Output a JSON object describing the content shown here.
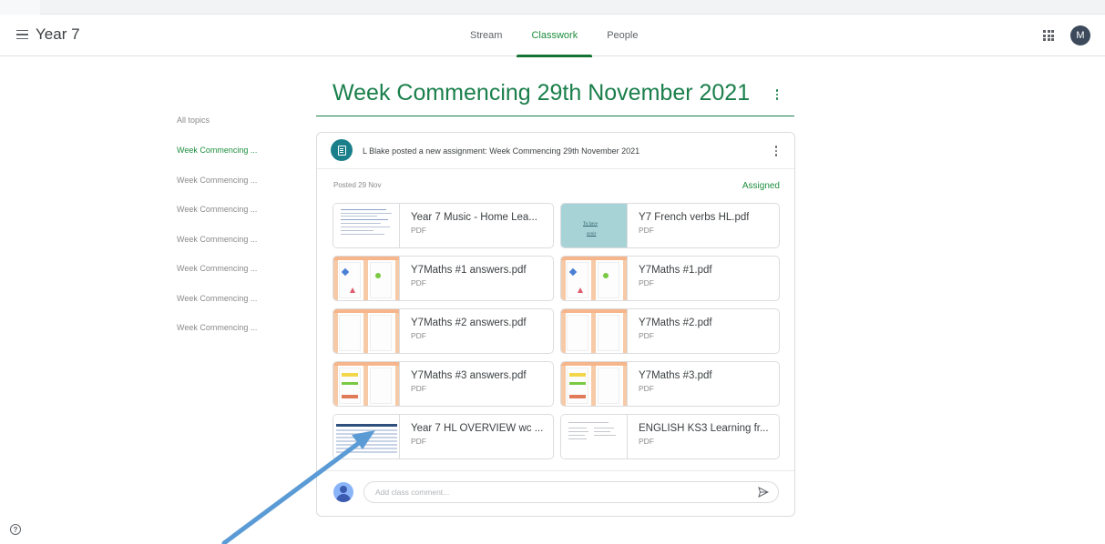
{
  "header": {
    "class_title": "Year 7",
    "tabs": [
      {
        "label": "Stream",
        "active": false
      },
      {
        "label": "Classwork",
        "active": true
      },
      {
        "label": "People",
        "active": false
      }
    ],
    "avatar_letter": "M"
  },
  "sidebar": {
    "all_topics": "All topics",
    "topics": [
      {
        "label": "Week Commencing ...",
        "active": true
      },
      {
        "label": "Week Commencing ...",
        "active": false
      },
      {
        "label": "Week Commencing ...",
        "active": false
      },
      {
        "label": "Week Commencing ...",
        "active": false
      },
      {
        "label": "Week Commencing ...",
        "active": false
      },
      {
        "label": "Week Commencing ...",
        "active": false
      },
      {
        "label": "Week Commencing ...",
        "active": false
      }
    ]
  },
  "main": {
    "topic_heading": "Week Commencing 29th November 2021",
    "post": {
      "text": "L Blake posted a new assignment: Week Commencing 29th November 2021",
      "posted_date": "Posted 29 Nov",
      "status": "Assigned",
      "attachments": [
        {
          "title": "Year 7 Music - Home Lea...",
          "type": "PDF",
          "thumb": "doc"
        },
        {
          "title": "Y7 French verbs HL.pdf",
          "type": "PDF",
          "thumb": "teal",
          "thumb_text": [
            "To have",
            "avoir"
          ]
        },
        {
          "title": "Y7Maths #1 answers.pdf",
          "type": "PDF",
          "thumb": "maths"
        },
        {
          "title": "Y7Maths #1.pdf",
          "type": "PDF",
          "thumb": "maths"
        },
        {
          "title": "Y7Maths #2 answers.pdf",
          "type": "PDF",
          "thumb": "maths"
        },
        {
          "title": "Y7Maths #2.pdf",
          "type": "PDF",
          "thumb": "maths"
        },
        {
          "title": "Y7Maths #3 answers.pdf",
          "type": "PDF",
          "thumb": "maths"
        },
        {
          "title": "Y7Maths #3.pdf",
          "type": "PDF",
          "thumb": "maths"
        },
        {
          "title": "Year 7 HL OVERVIEW wc ...",
          "type": "PDF",
          "thumb": "overview"
        },
        {
          "title": "ENGLISH KS3 Learning fr...",
          "type": "PDF",
          "thumb": "english"
        }
      ],
      "comment_placeholder": "Add class comment..."
    }
  },
  "colors": {
    "accent_green": "#1a7f4b",
    "tab_active": "#1e8e3e",
    "arrow": "#5b9bd5"
  },
  "icons": [
    "menu-icon",
    "apps-grid-icon",
    "assignment-icon",
    "more-vert-icon",
    "send-icon",
    "help-icon",
    "user-avatar-icon"
  ]
}
